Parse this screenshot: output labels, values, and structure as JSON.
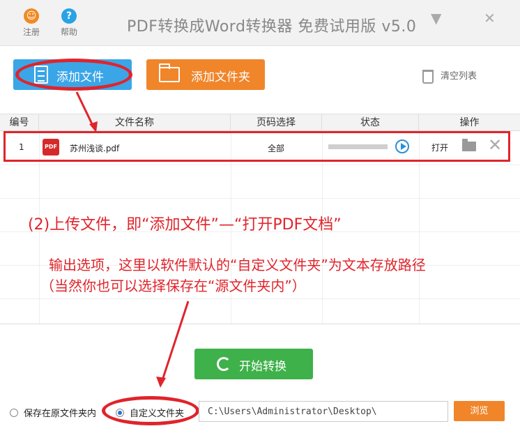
{
  "titlebar": {
    "register_label": "注册",
    "help_label": "帮助",
    "app_title": "PDF转换成Word转换器 免费试用版 v5.0",
    "minimize_glyph": "▼",
    "close_glyph": "✕"
  },
  "toolbar": {
    "add_file_label": "添加文件",
    "add_folder_label": "添加文件夹",
    "clear_list_label": "清空列表"
  },
  "table": {
    "headers": [
      "编号",
      "文件名称",
      "页码选择",
      "状态",
      "操作"
    ],
    "rows": [
      {
        "index": "1",
        "pdf_badge": "PDF",
        "filename": "苏州浅谈.pdf",
        "pages": "全部",
        "progress": 0,
        "open_label": "打开"
      }
    ]
  },
  "annotations": {
    "step2": "(2)上传文件，即“添加文件”—“打开PDF文档”",
    "output_line1": "输出选项，这里以软件默认的“自定义文件夹”为文本存放路径",
    "output_line2": "（当然你也可以选择保存在“源文件夹内”）"
  },
  "bottom": {
    "start_label": "开始转换",
    "radio_source_label": "保存在原文件夹内",
    "radio_custom_label": "自定义文件夹",
    "output_path": "C:\\Users\\Administrator\\Desktop\\",
    "browse_label": "浏览"
  },
  "colors": {
    "accent_blue": "#3aa6e8",
    "accent_orange": "#f0852a",
    "start_green": "#3eb14a",
    "annotation_red": "#e0242b"
  }
}
